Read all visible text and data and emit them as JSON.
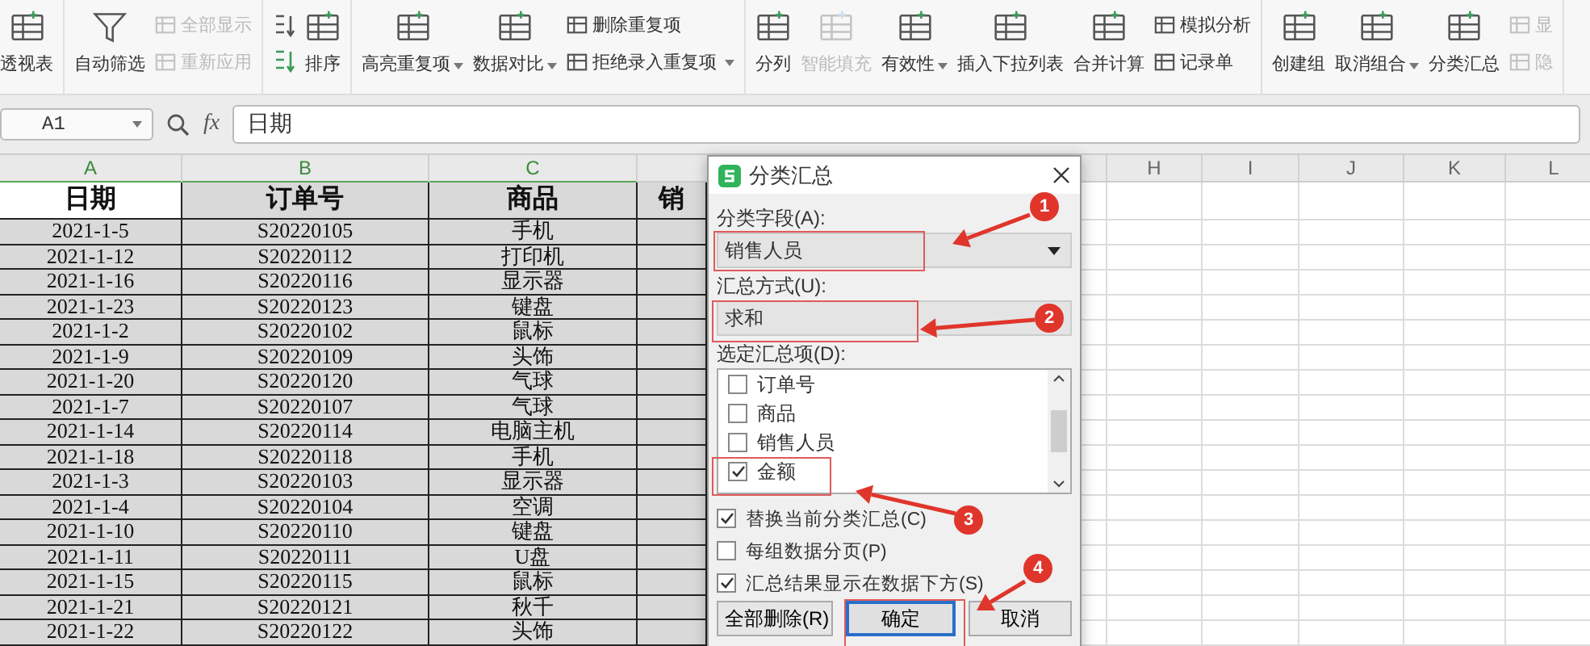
{
  "ribbon": {
    "groups": [
      {
        "items": [
          {
            "kind": "large",
            "label": "透视表",
            "dropdown": false,
            "disabled": false
          }
        ]
      },
      {
        "items": [
          {
            "kind": "large",
            "label": "自动筛选",
            "dropdown": false,
            "disabled": false
          },
          {
            "kind": "stack",
            "items": [
              {
                "label": "全部显示",
                "dropdown": false,
                "disabled": true
              },
              {
                "label": "重新应用",
                "dropdown": false,
                "disabled": true
              }
            ]
          }
        ]
      },
      {
        "items": [
          {
            "kind": "sort-pair"
          },
          {
            "kind": "large",
            "label": "排序",
            "dropdown": false,
            "disabled": false
          }
        ]
      },
      {
        "items": [
          {
            "kind": "large",
            "label": "高亮重复项",
            "dropdown": true,
            "disabled": false
          },
          {
            "kind": "large",
            "label": "数据对比",
            "dropdown": true,
            "disabled": false
          },
          {
            "kind": "stack",
            "items": [
              {
                "label": "删除重复项",
                "dropdown": false,
                "disabled": false
              },
              {
                "label": "拒绝录入重复项",
                "dropdown": true,
                "disabled": false
              }
            ]
          }
        ]
      },
      {
        "items": [
          {
            "kind": "large",
            "label": "分列",
            "dropdown": false,
            "disabled": false
          },
          {
            "kind": "large",
            "label": "智能填充",
            "dropdown": false,
            "disabled": true
          },
          {
            "kind": "large",
            "label": "有效性",
            "dropdown": true,
            "disabled": false
          },
          {
            "kind": "large",
            "label": "插入下拉列表",
            "dropdown": false,
            "disabled": false
          },
          {
            "kind": "large",
            "label": "合并计算",
            "dropdown": false,
            "disabled": false
          },
          {
            "kind": "stack",
            "items": [
              {
                "label": "模拟分析",
                "dropdown": false,
                "disabled": false
              },
              {
                "label": "记录单",
                "dropdown": false,
                "disabled": false
              }
            ]
          }
        ]
      },
      {
        "items": [
          {
            "kind": "large",
            "label": "创建组",
            "dropdown": false,
            "disabled": false
          },
          {
            "kind": "large",
            "label": "取消组合",
            "dropdown": true,
            "disabled": false
          },
          {
            "kind": "large",
            "label": "分类汇总",
            "dropdown": false,
            "disabled": false
          },
          {
            "kind": "stack",
            "items": [
              {
                "label": "显",
                "dropdown": false,
                "disabled": true
              },
              {
                "label": "隐",
                "dropdown": false,
                "disabled": true
              }
            ]
          }
        ]
      }
    ]
  },
  "formula_bar": {
    "name_box": "A1",
    "fx_label": "fx",
    "formula": "日期"
  },
  "sheet": {
    "columns": [
      {
        "letter": "A",
        "selected": true
      },
      {
        "letter": "B",
        "selected": true
      },
      {
        "letter": "C",
        "selected": true
      },
      {
        "letter": "H",
        "selected": false
      },
      {
        "letter": "I",
        "selected": false
      },
      {
        "letter": "J",
        "selected": false
      },
      {
        "letter": "K",
        "selected": false
      },
      {
        "letter": "L",
        "selected": false
      }
    ],
    "header": [
      {
        "text": "日期",
        "selected": true
      },
      {
        "text": "订单号",
        "selected": false
      },
      {
        "text": "商品",
        "selected": false
      },
      {
        "text": "销",
        "selected": false
      }
    ],
    "rows": [
      [
        "2021-1-5",
        "S20220105",
        "手机"
      ],
      [
        "2021-1-12",
        "S20220112",
        "打印机"
      ],
      [
        "2021-1-16",
        "S20220116",
        "显示器"
      ],
      [
        "2021-1-23",
        "S20220123",
        "键盘"
      ],
      [
        "2021-1-2",
        "S20220102",
        "鼠标"
      ],
      [
        "2021-1-9",
        "S20220109",
        "头饰"
      ],
      [
        "2021-1-20",
        "S20220120",
        "气球"
      ],
      [
        "2021-1-7",
        "S20220107",
        "气球"
      ],
      [
        "2021-1-14",
        "S20220114",
        "电脑主机"
      ],
      [
        "2021-1-18",
        "S20220118",
        "手机"
      ],
      [
        "2021-1-3",
        "S20220103",
        "显示器"
      ],
      [
        "2021-1-4",
        "S20220104",
        "空调"
      ],
      [
        "2021-1-10",
        "S20220110",
        "键盘"
      ],
      [
        "2021-1-11",
        "S20220111",
        "U盘"
      ],
      [
        "2021-1-15",
        "S20220115",
        "鼠标"
      ],
      [
        "2021-1-21",
        "S20220121",
        "秋千"
      ],
      [
        "2021-1-22",
        "S20220122",
        "头饰"
      ]
    ]
  },
  "dialog": {
    "title": "分类汇总",
    "field_label": "分类字段(A):",
    "field_value": "销售人员",
    "method_label": "汇总方式(U):",
    "method_value": "求和",
    "items_label": "选定汇总项(D):",
    "items": [
      {
        "label": "订单号",
        "checked": false
      },
      {
        "label": "商品",
        "checked": false
      },
      {
        "label": "销售人员",
        "checked": false
      },
      {
        "label": "金额",
        "checked": true
      }
    ],
    "options": [
      {
        "label": "替换当前分类汇总(C)",
        "checked": true
      },
      {
        "label": "每组数据分页(P)",
        "checked": false
      },
      {
        "label": "汇总结果显示在数据下方(S)",
        "checked": true
      }
    ],
    "buttons": [
      {
        "label": "全部删除(R)",
        "focused": false
      },
      {
        "label": "确定",
        "focused": true
      },
      {
        "label": "取消",
        "focused": false
      }
    ]
  },
  "annotations": [
    {
      "number": "1"
    },
    {
      "number": "2"
    },
    {
      "number": "3"
    },
    {
      "number": "4"
    }
  ]
}
